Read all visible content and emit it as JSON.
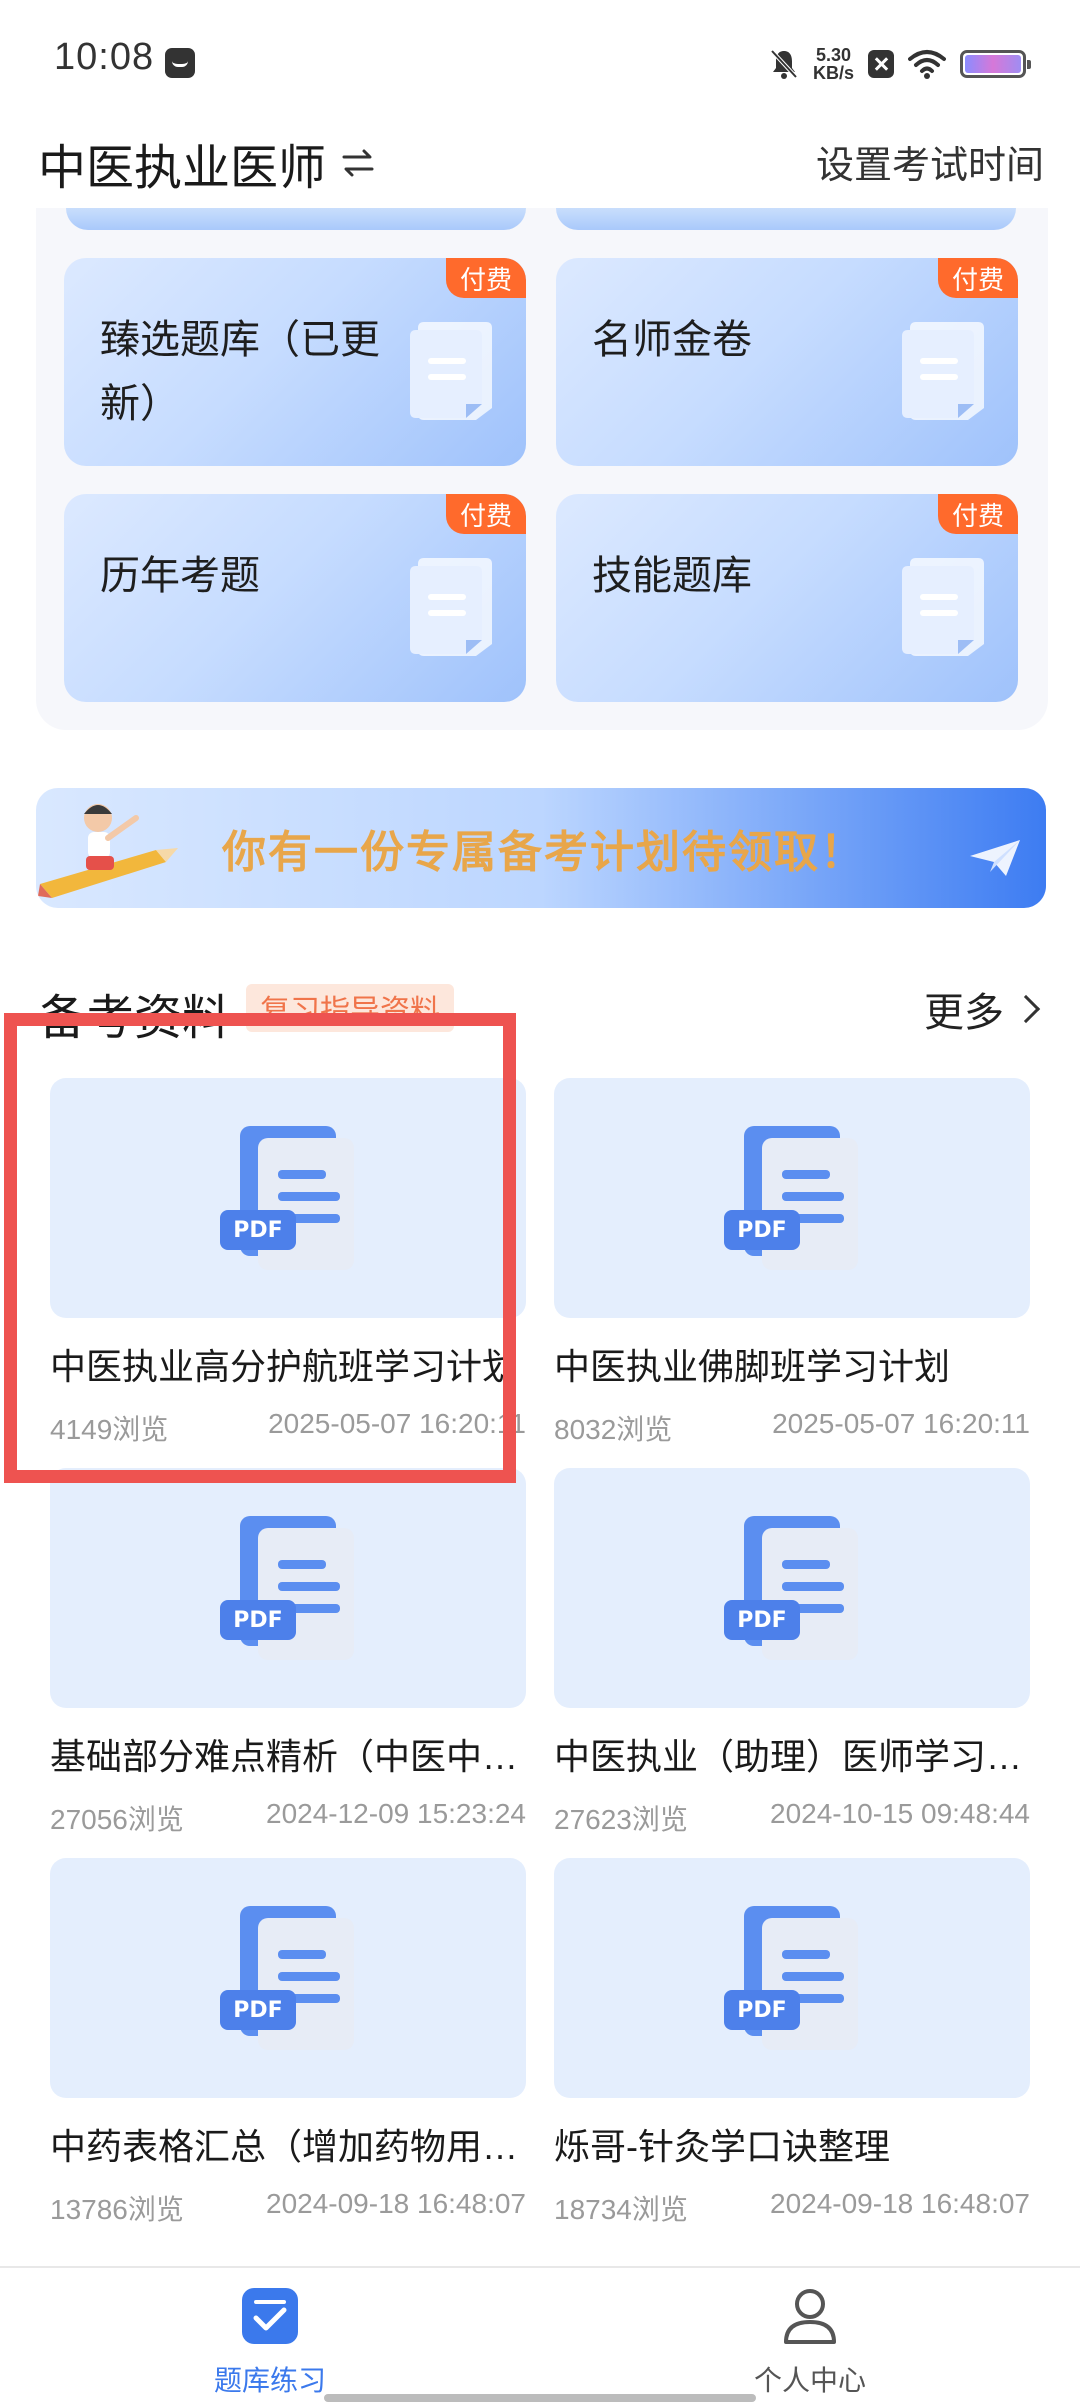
{
  "status_bar": {
    "time": "10:08",
    "net_speed_value": "5.30",
    "net_speed_unit": "KB/s"
  },
  "header": {
    "title": "中医执业医师",
    "action": "设置考试时间"
  },
  "paid_cards": [
    {
      "title": "臻选题库（已更新）",
      "badge": "付费"
    },
    {
      "title": "名师金卷",
      "badge": "付费"
    },
    {
      "title": "历年考题",
      "badge": "付费"
    },
    {
      "title": "技能题库",
      "badge": "付费"
    }
  ],
  "banner": {
    "text": "你有一份专属备考计划待领取！"
  },
  "section": {
    "title": "备考资料",
    "tag": "复习指导资料",
    "more": "更多"
  },
  "materials": [
    {
      "title": "中医执业高分护航班学习计划",
      "views": "4149浏览",
      "date": "2025-05-07 16:20:11"
    },
    {
      "title": "中医执业佛脚班学习计划",
      "views": "8032浏览",
      "date": "2025-05-07 16:20:11"
    },
    {
      "title": "基础部分难点精析（中医中…",
      "views": "27056浏览",
      "date": "2024-12-09 15:23:24"
    },
    {
      "title": "中医执业（助理）医师学习…",
      "views": "27623浏览",
      "date": "2024-10-15 09:48:44"
    },
    {
      "title": "中药表格汇总（增加药物用…",
      "views": "13786浏览",
      "date": "2024-09-18 16:48:07"
    },
    {
      "title": "烁哥-针灸学口诀整理",
      "views": "18734浏览",
      "date": "2024-09-18 16:48:07"
    }
  ],
  "pdf_label": "PDF",
  "bottom_nav": {
    "practice": "题库练习",
    "me": "个人中心"
  },
  "colors": {
    "accent": "#3b79ec",
    "paid_badge": "#ff6a2c",
    "highlight": "#ee5350"
  }
}
